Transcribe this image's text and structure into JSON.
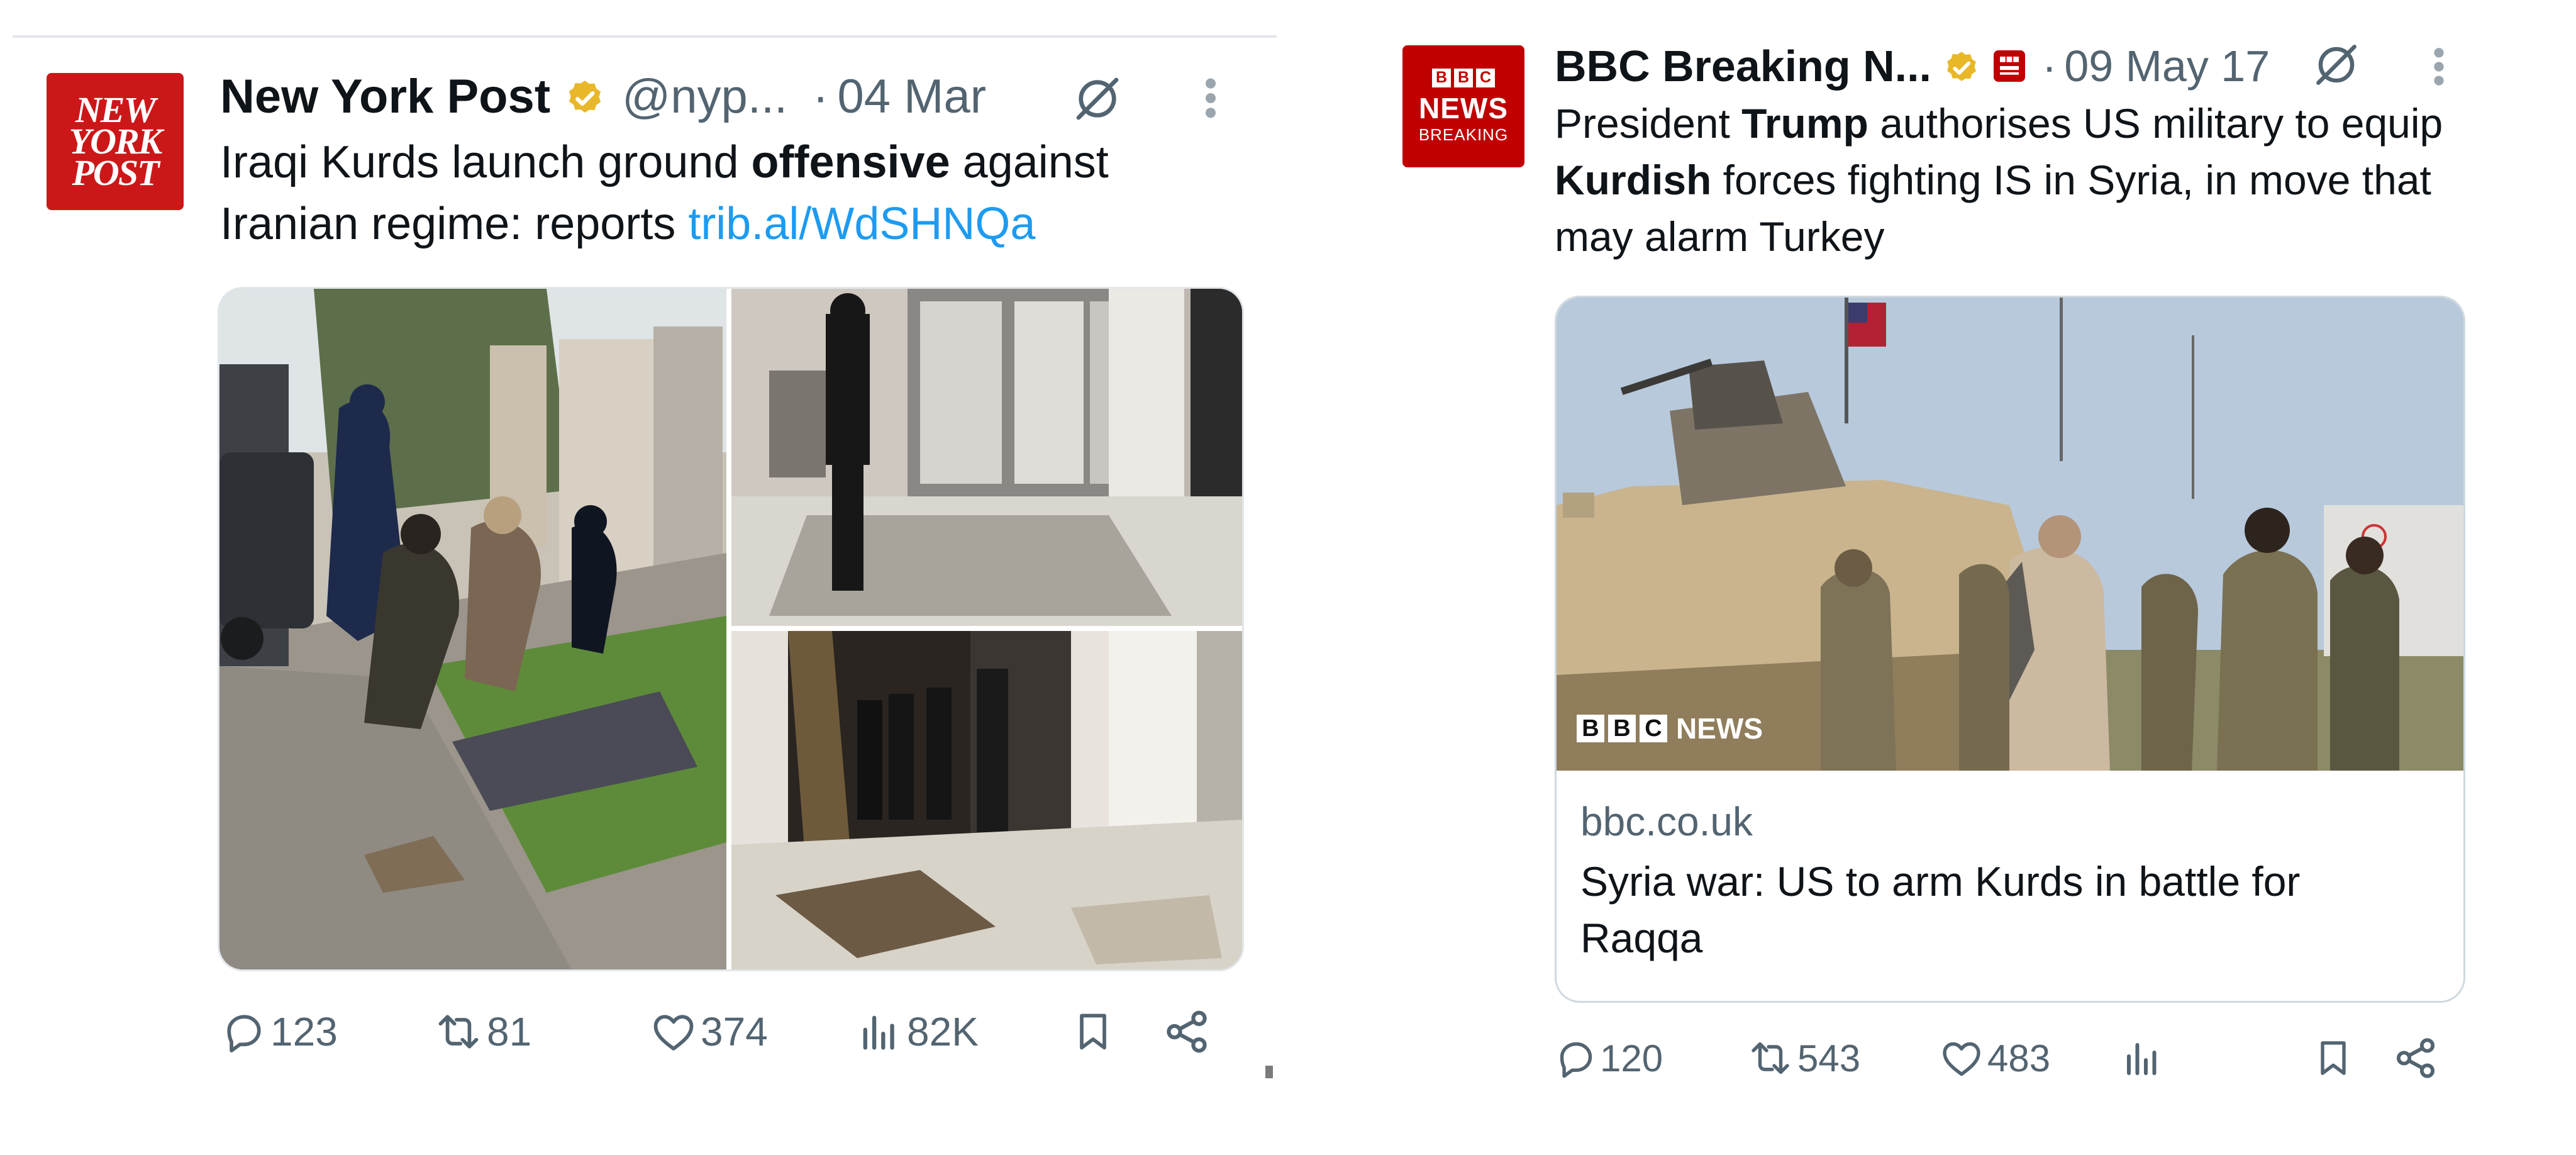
{
  "tweets": [
    {
      "account_name": "New York Post",
      "handle": "@nyp...",
      "separator": "·",
      "date": "04 Mar",
      "avatar_text": [
        "NEW",
        "YORK",
        "POST"
      ],
      "text_parts": {
        "a": "Iraqi Kurds launch ground ",
        "b": "offensive",
        "c": " against Iranian regime: reports ",
        "link": "trib.al/WdSHNQa"
      },
      "stats": {
        "replies": "123",
        "reposts": "81",
        "likes": "374",
        "views": "82K"
      },
      "media": [
        "Family seated on blankets on grass beside a street",
        "Man photographing debris in a house",
        "Damaged entrance hall with broken tiles"
      ]
    },
    {
      "account_name": "BBC Breaking N...",
      "separator": "·",
      "date": "09 May 17",
      "avatar_text": {
        "blocks": [
          "B",
          "B",
          "C"
        ],
        "news": "NEWS",
        "breaking": "BREAKING"
      },
      "text_parts": {
        "a": "President ",
        "b": "Trump",
        "c": " authorises US military to equip ",
        "d": "Kurdish",
        "e": " forces fighting IS in Syria, in move that may alarm Turkey"
      },
      "card": {
        "domain": "bbc.co.uk",
        "title": "Syria war: US to arm Kurds in battle for Raqqa",
        "watermark_blocks": [
          "B",
          "B",
          "C"
        ],
        "watermark_text": "NEWS"
      },
      "stats": {
        "replies": "120",
        "reposts": "543",
        "likes": "483"
      }
    }
  ],
  "colors": {
    "nyp_red": "#cc1719",
    "bbc_red": "#c00000",
    "link_blue": "#1d9bf0",
    "muted_gray": "#536471",
    "verified_gold": "#e8b829"
  },
  "icons": [
    "grok-icon",
    "more-icon",
    "reply-icon",
    "repost-icon",
    "like-icon",
    "views-icon",
    "bookmark-icon",
    "share-icon",
    "verified-badge-icon",
    "affiliate-badge-icon"
  ]
}
